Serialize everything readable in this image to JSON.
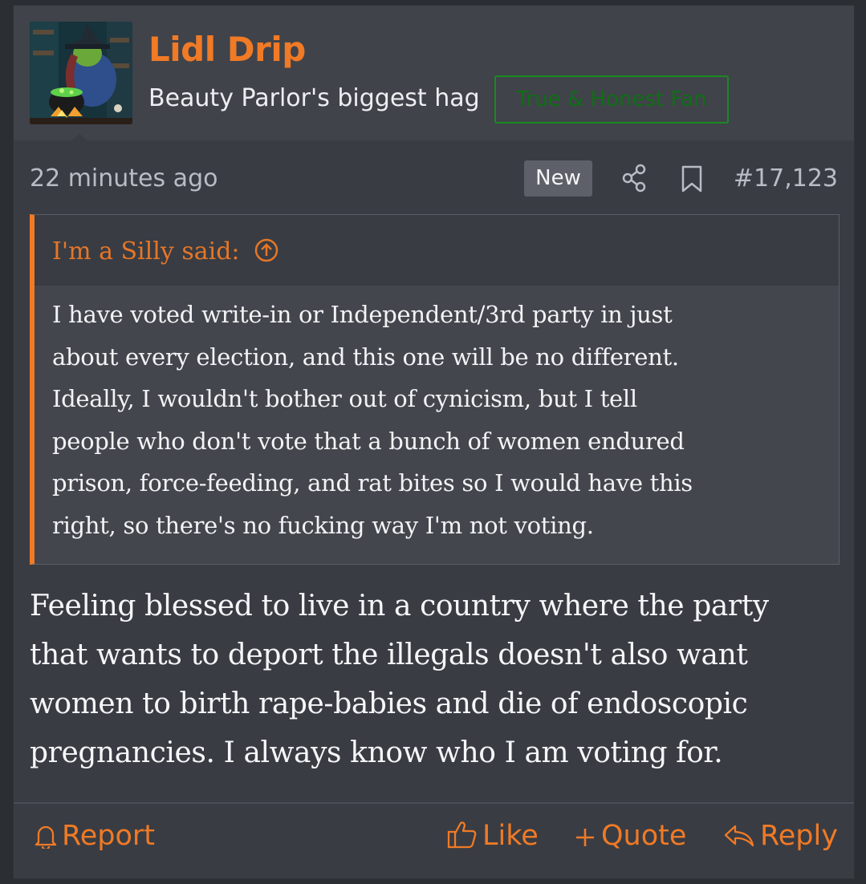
{
  "user": {
    "name": "Lidl Drip",
    "title": "Beauty Parlor's biggest hag",
    "banner": "True & Honest Fan",
    "avatar_icon": "witch-avatar-icon"
  },
  "meta": {
    "timestamp": "22 minutes ago",
    "new_badge": "New",
    "post_number": "#17,123"
  },
  "quote": {
    "attribution": "I'm a Silly said:",
    "lines": [
      "I have voted write-in or Independent/3rd party in just",
      "about every election, and this one will be no different.",
      "Ideally, I wouldn't bother out of cynicism, but I tell",
      "people who don't vote that a bunch of women endured",
      "prison, force-feeding, and rat bites so I would have this",
      "right, so there's no fucking way I'm not voting."
    ]
  },
  "message": {
    "lines": [
      "Feeling blessed to live in a country where the party",
      "that wants to deport the illegals doesn't also want",
      "women to birth rape-babies and die of endoscopic",
      "pregnancies. I always know who I am voting for."
    ]
  },
  "actions": {
    "report": "Report",
    "like": "Like",
    "quote": "Quote",
    "reply": "Reply"
  },
  "colors": {
    "accent": "#f07a26",
    "banner_green": "#1a8a20",
    "background": "#393c43"
  }
}
